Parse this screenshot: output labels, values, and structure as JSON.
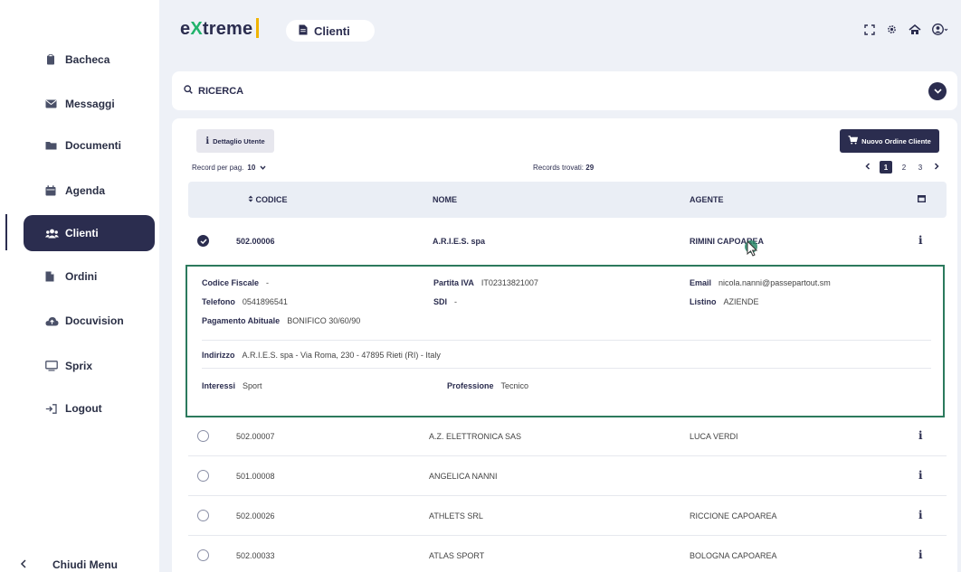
{
  "app": {
    "logo_pre": "e",
    "logo_x": "X",
    "logo_post": "treme",
    "page_title": "Clienti"
  },
  "sidebar": {
    "items": [
      {
        "label": "Bacheca",
        "icon": "clipboard-icon"
      },
      {
        "label": "Messaggi",
        "icon": "envelope-icon"
      },
      {
        "label": "Documenti",
        "icon": "folder-icon"
      },
      {
        "label": "Agenda",
        "icon": "calendar-icon"
      },
      {
        "label": "Clienti",
        "icon": "users-icon"
      },
      {
        "label": "Ordini",
        "icon": "file-icon"
      },
      {
        "label": "Docuvision",
        "icon": "cloud-upload-icon"
      },
      {
        "label": "Sprix",
        "icon": "monitor-icon"
      },
      {
        "label": "Logout",
        "icon": "logout-icon"
      }
    ],
    "collapse_label": "Chiudi Menu"
  },
  "search": {
    "label": "RICERCA"
  },
  "toolbar": {
    "detail_button": "Dettaglio Utente",
    "new_order_button": "Nuovo Ordine Cliente",
    "records_per_page_label": "Record per pag.",
    "records_per_page_value": "10",
    "records_found_label": "Records trovati:",
    "records_found_value": "29",
    "pages": [
      "1",
      "2",
      "3"
    ],
    "current_page": "1"
  },
  "table": {
    "columns": {
      "codice": "CODICE",
      "nome": "NOME",
      "agente": "AGENTE"
    },
    "selected_row": {
      "codice": "502.00006",
      "nome": "A.R.I.E.S. spa",
      "agente": "RIMINI CAPOAREA"
    },
    "rows": [
      {
        "codice": "502.00007",
        "nome": "A.Z. ELETTRONICA SAS",
        "agente": "LUCA VERDI"
      },
      {
        "codice": "501.00008",
        "nome": "ANGELICA NANNI",
        "agente": ""
      },
      {
        "codice": "502.00026",
        "nome": "ATHLETS SRL",
        "agente": "RICCIONE CAPOAREA"
      },
      {
        "codice": "502.00033",
        "nome": "ATLAS SPORT",
        "agente": "BOLOGNA CAPOAREA"
      }
    ]
  },
  "detail": {
    "codice_fiscale_label": "Codice Fiscale",
    "codice_fiscale": "-",
    "partita_iva_label": "Partita IVA",
    "partita_iva": "IT02313821007",
    "email_label": "Email",
    "email": "nicola.nanni@passepartout.sm",
    "telefono_label": "Telefono",
    "telefono": "0541896541",
    "sdi_label": "SDI",
    "sdi": "-",
    "listino_label": "Listino",
    "listino": "AZIENDE",
    "pagamento_label": "Pagamento Abituale",
    "pagamento": "BONIFICO 30/60/90",
    "indirizzo_label": "Indirizzo",
    "indirizzo": "A.R.I.E.S. spa - Via Roma, 230 - 47895 Rieti (RI) - Italy",
    "interessi_label": "Interessi",
    "interessi": "Sport",
    "professione_label": "Professione",
    "professione": "Tecnico"
  },
  "colors": {
    "primary": "#2b2d4f",
    "accent_green": "#21b36b",
    "logo_bar": "#f0b400",
    "detail_border": "#2c7a5d"
  }
}
